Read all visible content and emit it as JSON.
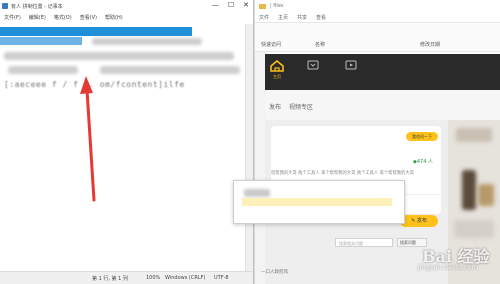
{
  "notepad": {
    "title": "有人 拼制位置 - 记事本",
    "window_controls": [
      "—",
      "☐",
      "✕"
    ],
    "menu": [
      "文件(F)",
      "编辑(E)",
      "格式(O)",
      "查看(V)",
      "帮助(H)"
    ],
    "text_line": "[:aeceee  f  /    f j.  om/fcontent]ilfe",
    "status": {
      "position": "第 1 行, 第 1 列",
      "zoom": "100%",
      "line_ending": "Windows (CRLF)",
      "encoding": "UTF-8"
    }
  },
  "explorer": {
    "title": "| files",
    "ribbon": [
      "文件",
      "主页",
      "共享",
      "查看"
    ],
    "columns": [
      "快速访问",
      "名称",
      "修改日期"
    ]
  },
  "app": {
    "tabs": [
      {
        "label": "主页",
        "icon": "home-icon"
      },
      {
        "label": "",
        "icon": "message-icon"
      },
      {
        "label": "",
        "icon": "video-icon"
      }
    ],
    "subnav": [
      "发布",
      "视频专区"
    ],
    "card": {
      "pill_button": "我也问一下",
      "count": "◆474 人",
      "body": "您帮我的大哥 两个工具人 来个帮帮我的大哥 两个工具人 来个帮帮我的大哥"
    },
    "send_button": "✎ 发布",
    "search_placeholder": "搜索相关问题",
    "search_button": "搜索问题",
    "footer_text": "一口人政府风"
  },
  "watermark": {
    "brand": "Bai 经验",
    "url": "jingyan.baidu.com"
  },
  "colors": {
    "selection": "#1e8fd8",
    "accent": "#ffc21a",
    "dark_bar": "#2a2a2a",
    "arrow": "#e53935"
  }
}
